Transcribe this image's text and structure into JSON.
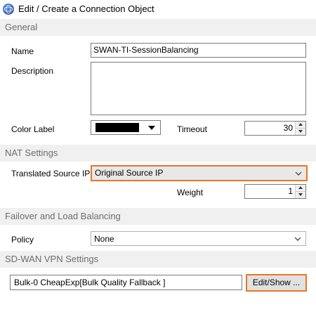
{
  "window": {
    "title": "Edit / Create a Connection Object",
    "icon": "app-globe-icon"
  },
  "general": {
    "header": "General",
    "name_label": "Name",
    "name_value": "SWAN-TI-SessionBalancing",
    "description_label": "Description",
    "description_value": "",
    "color_label_label": "Color Label",
    "color_label_value": "#000000",
    "timeout_label": "Timeout",
    "timeout_value": "30"
  },
  "nat": {
    "header": "NAT Settings",
    "translated_source_ip_label": "Translated Source IP",
    "translated_source_ip_value": "Original Source IP",
    "weight_label": "Weight",
    "weight_value": "1"
  },
  "failover": {
    "header": "Failover and Load Balancing",
    "policy_label": "Policy",
    "policy_value": "None"
  },
  "sdwan": {
    "header": "SD-WAN VPN Settings",
    "value": "Bulk-0 CheapExp[Bulk Quality Fallback ]",
    "edit_show_label": "Edit/Show ..."
  },
  "colors": {
    "accent_focus": "#e87722",
    "section_bg": "#f0f0f0",
    "section_text": "#6d6d6d"
  }
}
